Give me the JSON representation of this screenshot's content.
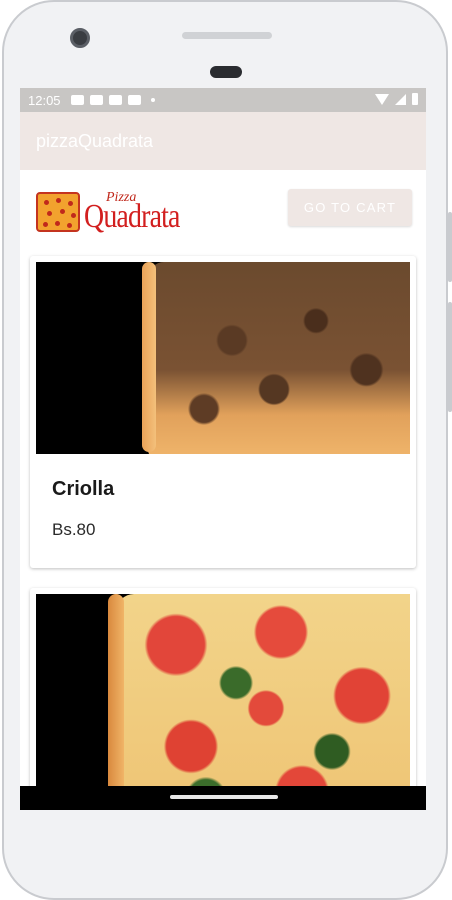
{
  "statusbar": {
    "time": "12:05"
  },
  "appbar": {
    "title": "pizzaQuadrata"
  },
  "header": {
    "logo_small": "Pizza",
    "logo_large": "Quadrata",
    "cart_button": "GO TO CART"
  },
  "products": [
    {
      "name": "Criolla",
      "price": "Bs.80"
    },
    {
      "name": "",
      "price": ""
    }
  ],
  "colors": {
    "appbar": "#efe7e4",
    "statusbar": "#c8c6c4",
    "logo_red": "#d21f1f"
  }
}
